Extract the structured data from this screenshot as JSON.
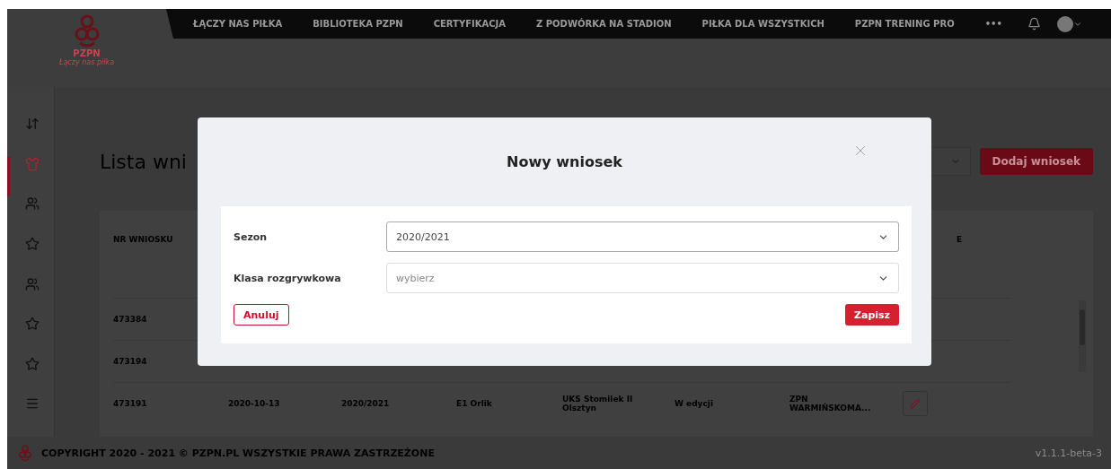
{
  "header": {
    "logo": {
      "name": "PZPN",
      "slogan": "Łączy nas piłka"
    },
    "nav": [
      "ŁĄCZY NAS PIŁKA",
      "BIBLIOTEKA PZPN",
      "CERTYFIKACJA",
      "Z PODWÓRKA NA STADION",
      "PIŁKA DLA WSZYSTKICH",
      "PZPN TRENING PRO"
    ],
    "more": "•••"
  },
  "sidebar": {
    "items": [
      {
        "kind": "sort",
        "selected": false
      },
      {
        "kind": "shirt",
        "selected": true
      },
      {
        "kind": "users",
        "selected": false
      },
      {
        "kind": "star",
        "selected": false
      },
      {
        "kind": "users",
        "selected": false
      },
      {
        "kind": "star",
        "selected": false
      },
      {
        "kind": "star",
        "selected": false
      },
      {
        "kind": "menu",
        "selected": false
      }
    ]
  },
  "main": {
    "title": "Lista wni",
    "add_button": "Dodaj wniosek"
  },
  "table": {
    "column_1": "NR WNIOSKU",
    "column_9": "E",
    "rows": [
      {
        "cells": [
          "473384"
        ]
      },
      {
        "cells": [
          "473194"
        ]
      },
      {
        "cells": [
          "473191",
          "2020-10-13",
          "2020/2021",
          "E1 Orlik",
          "UKS Stomilek II Olsztyn",
          "W edycji",
          "ZPN WARMIŃSKOMA..."
        ],
        "editable": true
      }
    ]
  },
  "footer": {
    "copyright": "COPYRIGHT 2020 - 2021 © PZPN.PL WSZYSTKIE PRAWA ZASTRZEŻONE",
    "version": "v1.1.1-beta-3"
  },
  "modal": {
    "title": "Nowy wniosek",
    "fields": [
      {
        "label": "Sezon",
        "value": "2020/2021"
      },
      {
        "label": "Klasa rozgrywkowa",
        "placeholder": "wybierz"
      }
    ],
    "cancel": "Anuluj",
    "save": "Zapisz"
  }
}
